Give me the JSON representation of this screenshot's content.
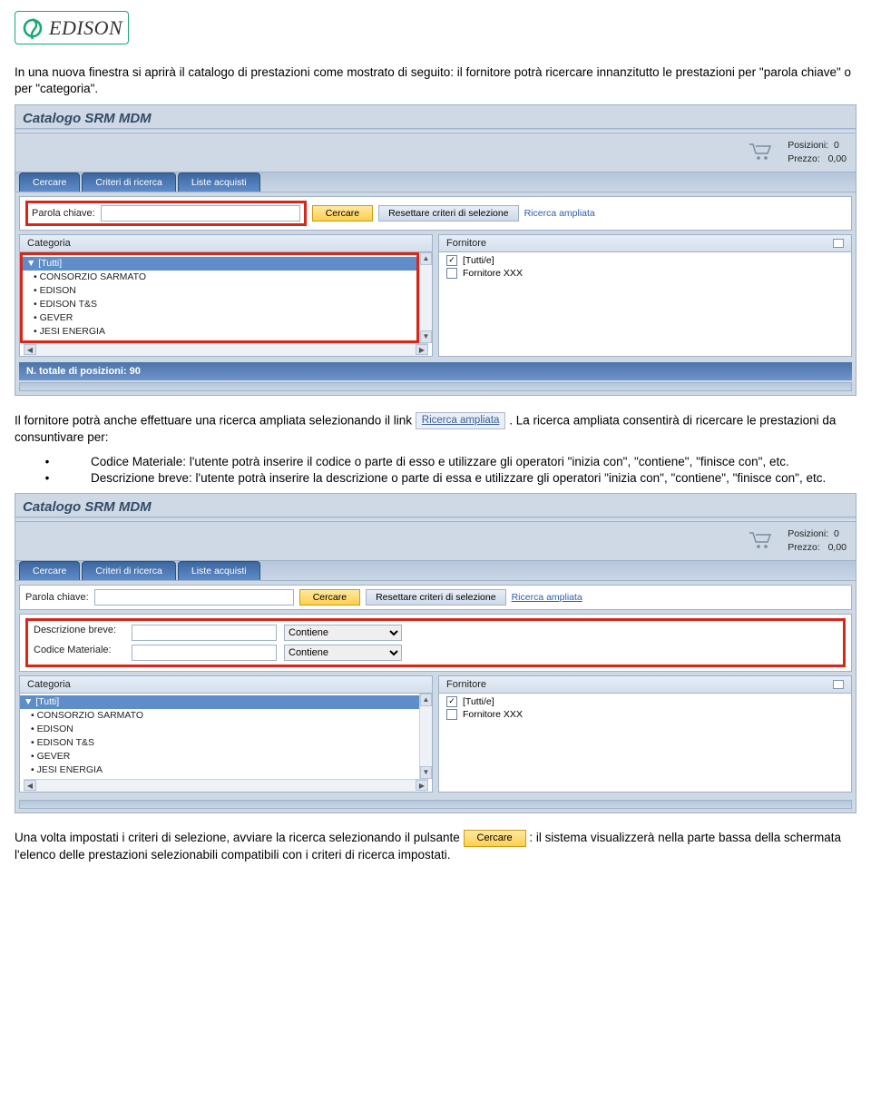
{
  "logo": {
    "name": "EDISON"
  },
  "doc": {
    "p1": "In una nuova finestra si aprirà il catalogo di prestazioni come mostrato di seguito: il fornitore potrà ricercare innanzitutto le prestazioni per \"parola chiave\" o per \"categoria\".",
    "p2a": "Il fornitore potrà anche effettuare una ricerca ampliata selezionando il link ",
    "p2_link": "Ricerca ampliata",
    "p2b": ". La ricerca ampliata consentirà di ricercare le prestazioni da consuntivare per:",
    "bullet1": "Codice Materiale: l'utente potrà inserire il codice o parte di esso e utilizzare gli operatori \"inizia con\", \"contiene\", \"finisce con\", etc.",
    "bullet2": "Descrizione breve: l'utente potrà inserire la descrizione o parte di essa e utilizzare gli operatori \"inizia con\", \"contiene\", \"finisce con\", etc.",
    "p3a": "Una volta impostati i criteri di selezione, avviare la ricerca selezionando il pulsante ",
    "p3_btn": "Cercare",
    "p3b": ": il sistema visualizzerà nella parte bassa della schermata l'elenco delle prestazioni selezionabili compatibili con i criteri di ricerca impostati."
  },
  "srm": {
    "title": "Catalogo SRM MDM",
    "cart": {
      "pos_label": "Posizioni:",
      "pos_value": "0",
      "price_label": "Prezzo:",
      "price_value": "0,00"
    },
    "tabs": [
      "Cercare",
      "Criteri di ricerca",
      "Liste acquisti"
    ],
    "search": {
      "keyword_label": "Parola chiave:",
      "btn_search": "Cercare",
      "btn_reset": "Resettare criteri di selezione",
      "link_adv": "Ricerca ampliata"
    },
    "adv": {
      "row1_label": "Descrizione breve:",
      "row2_label": "Codice Materiale:",
      "op": "Contiene"
    },
    "cat_panel": {
      "title": "Categoria",
      "items": [
        "▼ [Tutti]",
        "• CONSORZIO SARMATO",
        "• EDISON",
        "• EDISON T&S",
        "• GEVER",
        "• JESI ENERGIA"
      ]
    },
    "forn_panel": {
      "title": "Fornitore",
      "items": [
        {
          "checked": true,
          "label": "[Tutti/e]"
        },
        {
          "checked": false,
          "label": "Fornitore XXX"
        }
      ]
    },
    "footer": "N. totale di posizioni: 90"
  }
}
